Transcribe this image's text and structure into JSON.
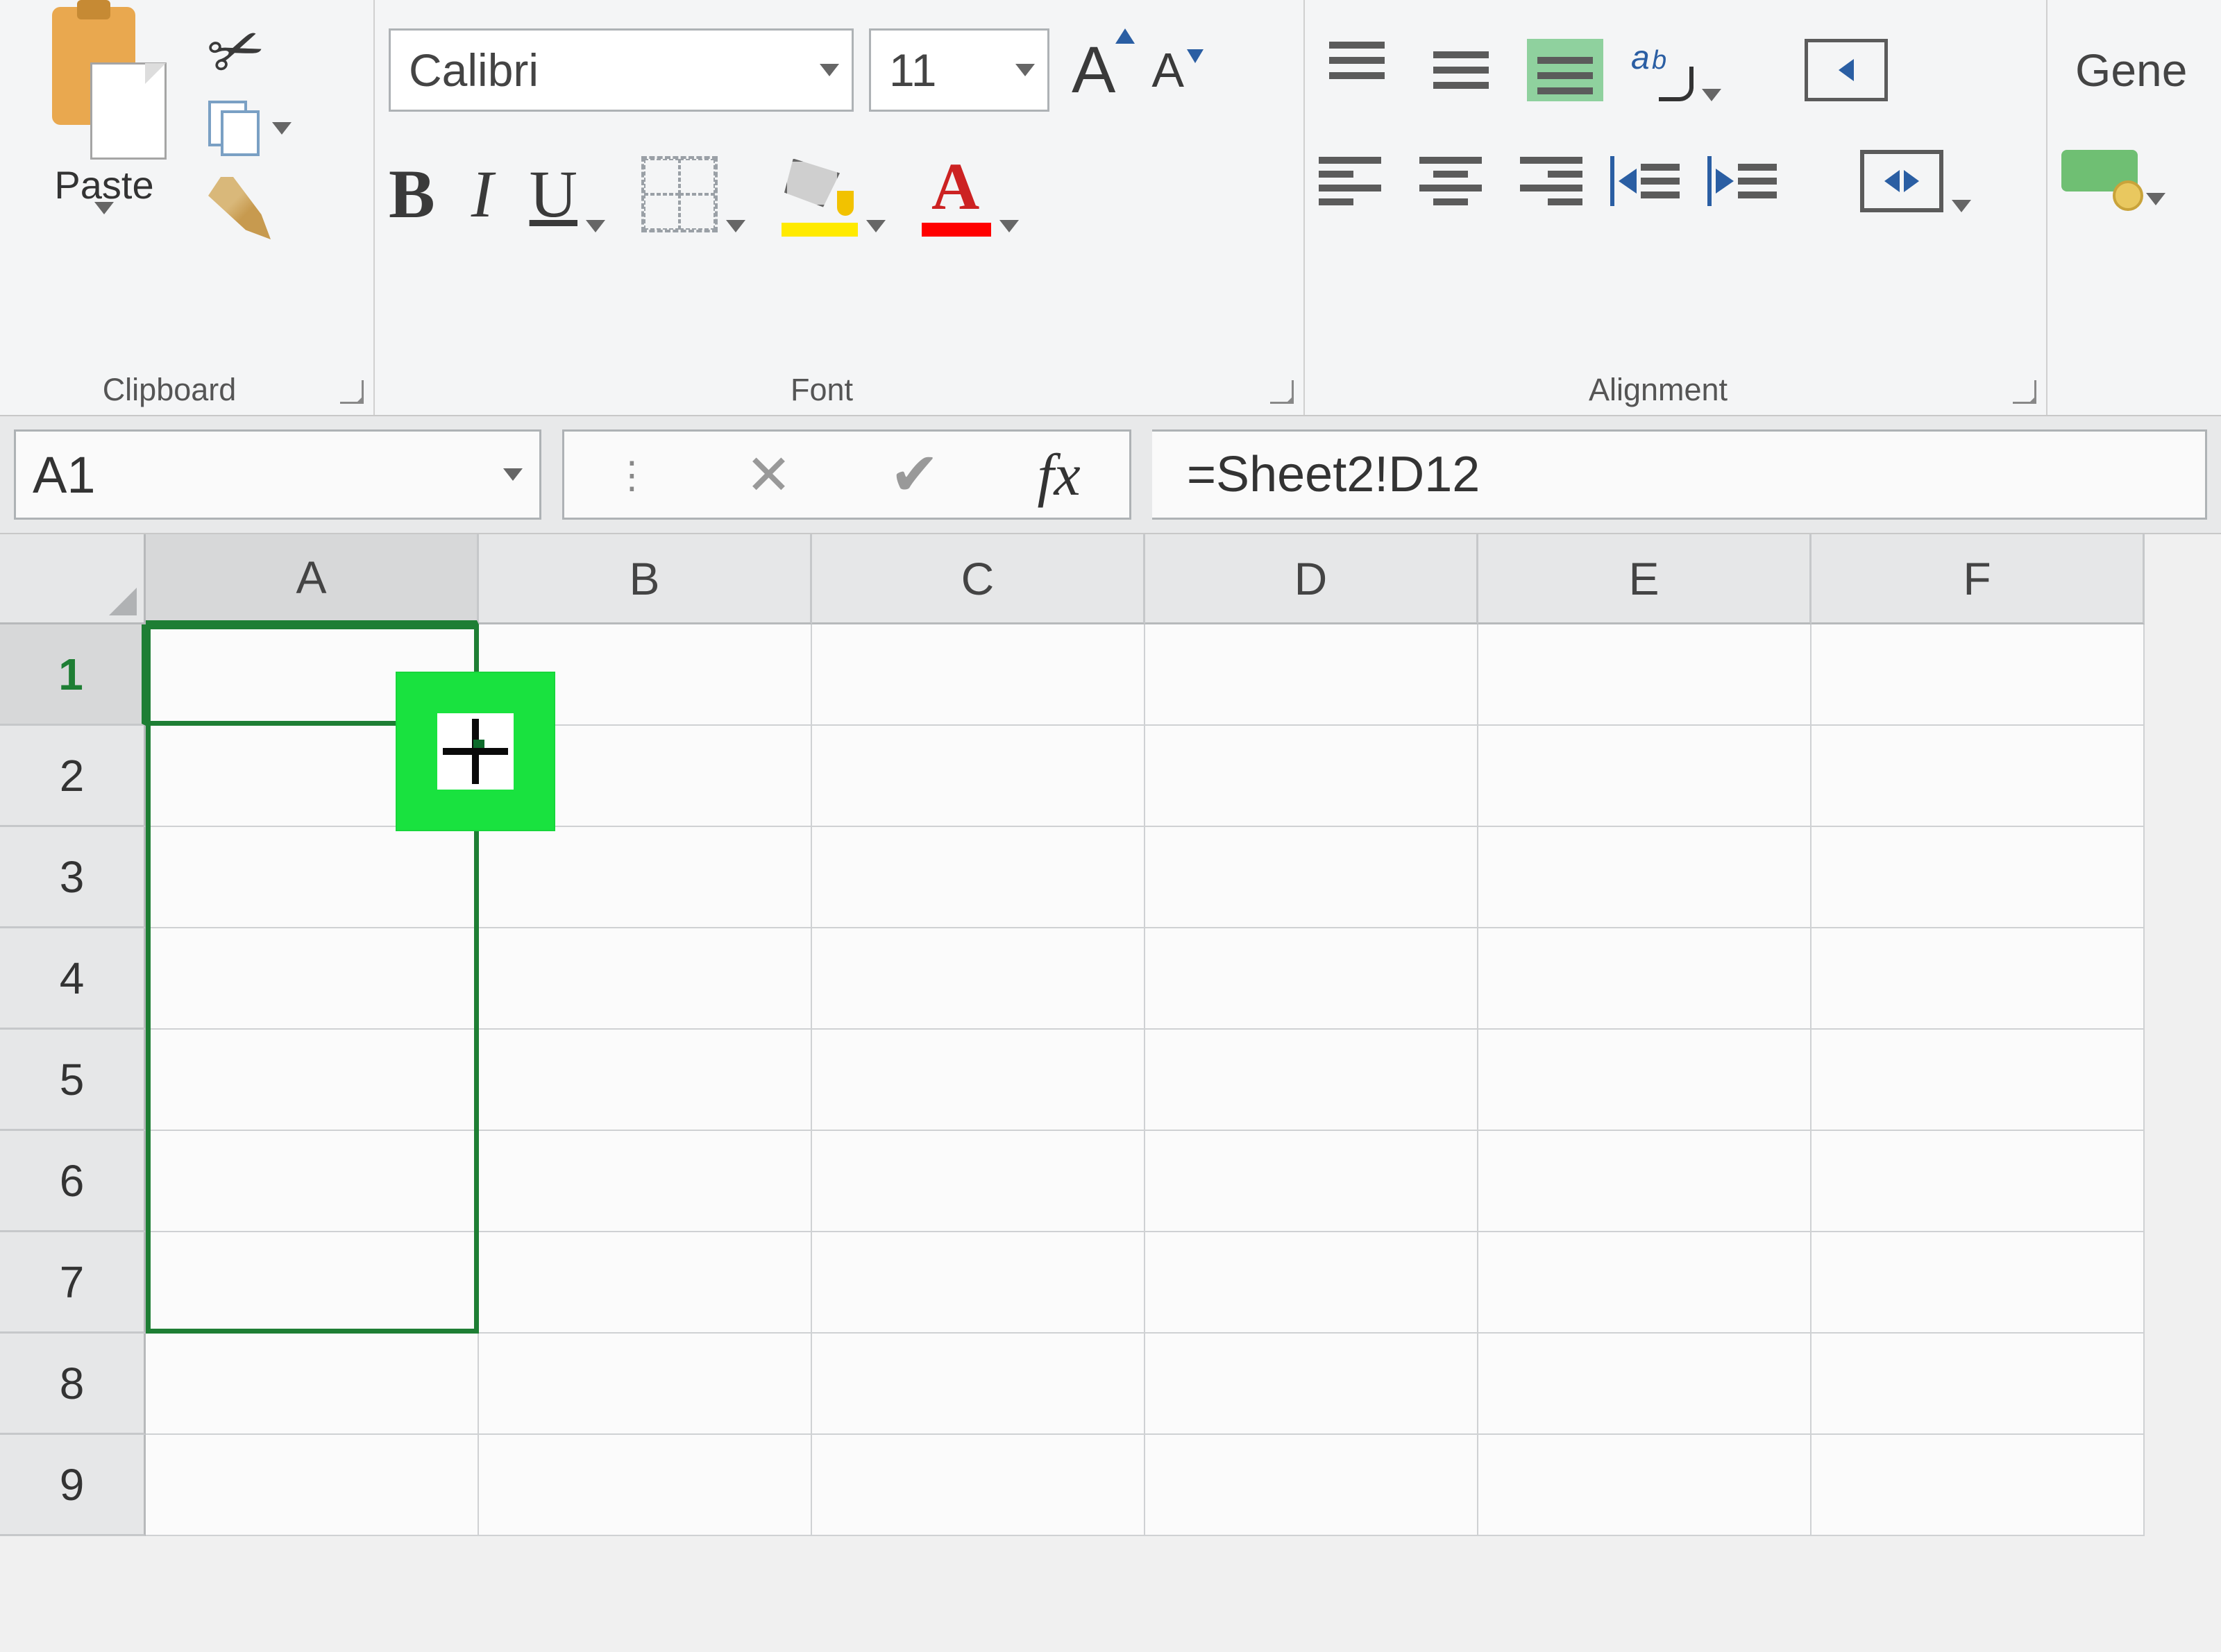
{
  "ribbon": {
    "clipboard": {
      "label": "Clipboard",
      "paste": "Paste"
    },
    "font": {
      "label": "Font",
      "name": "Calibri",
      "size": "11"
    },
    "alignment": {
      "label": "Alignment"
    },
    "number": {
      "format": "Gene"
    }
  },
  "formula_bar": {
    "name_box": "A1",
    "fx_label": "fx",
    "formula": "=Sheet2!D12"
  },
  "grid": {
    "columns": [
      "A",
      "B",
      "C",
      "D",
      "E",
      "F"
    ],
    "rows": [
      "1",
      "2",
      "3",
      "4",
      "5",
      "6",
      "7",
      "8",
      "9"
    ],
    "active_cell": "A1",
    "selection": "A1:A7"
  }
}
